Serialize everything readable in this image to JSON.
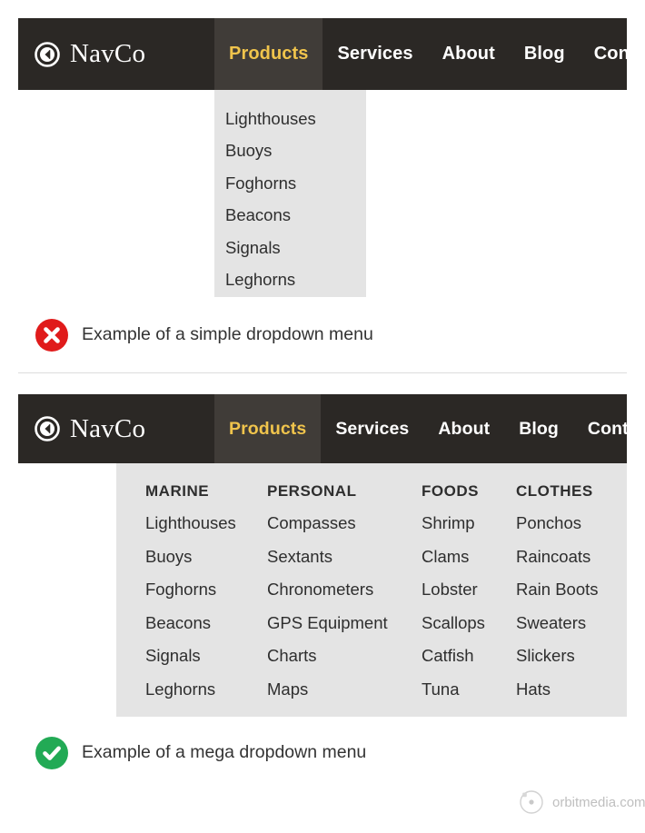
{
  "brand": {
    "name": "NavCo",
    "logo_icon": "navco-circle-marker-icon"
  },
  "nav": {
    "items": [
      {
        "label": "Products",
        "active": true
      },
      {
        "label": "Services",
        "active": false
      },
      {
        "label": "About",
        "active": false
      },
      {
        "label": "Blog",
        "active": false
      },
      {
        "label": "Contact",
        "active": false
      }
    ]
  },
  "simple_dropdown": {
    "items": [
      "Lighthouses",
      "Buoys",
      "Foghorns",
      "Beacons",
      "Signals",
      "Leghorns"
    ]
  },
  "mega_dropdown": {
    "columns": [
      {
        "heading": "MARINE",
        "links": [
          "Lighthouses",
          "Buoys",
          "Foghorns",
          "Beacons",
          "Signals",
          "Leghorns"
        ]
      },
      {
        "heading": "PERSONAL",
        "links": [
          "Compasses",
          "Sextants",
          "Chronometers",
          "GPS Equipment",
          "Charts",
          "Maps"
        ]
      },
      {
        "heading": "FOODS",
        "links": [
          "Shrimp",
          "Clams",
          "Lobster",
          "Scallops",
          "Catfish",
          "Tuna"
        ]
      },
      {
        "heading": "CLOTHES",
        "links": [
          "Ponchos",
          "Raincoats",
          "Rain Boots",
          "Sweaters",
          "Slickers",
          "Hats"
        ]
      }
    ]
  },
  "captions": {
    "simple": {
      "icon": "red-x-circle-icon",
      "text": "Example of a simple dropdown menu"
    },
    "mega": {
      "icon": "green-check-circle-icon",
      "text": "Example of a mega dropdown menu"
    }
  },
  "watermark": {
    "icon": "orbit-logo-icon",
    "text": "orbitmedia.com"
  },
  "colors": {
    "navbar_bg": "#2b2825",
    "active_tab_bg": "#403c38",
    "active_tab_text": "#f0c44c",
    "dropdown_bg": "#e4e4e4",
    "dropdown_text": "#2e2e2e",
    "error_red": "#e01b1b",
    "success_green": "#22aa55",
    "watermark_gray": "#bfbfbf",
    "divider_gray": "#dddddd"
  }
}
